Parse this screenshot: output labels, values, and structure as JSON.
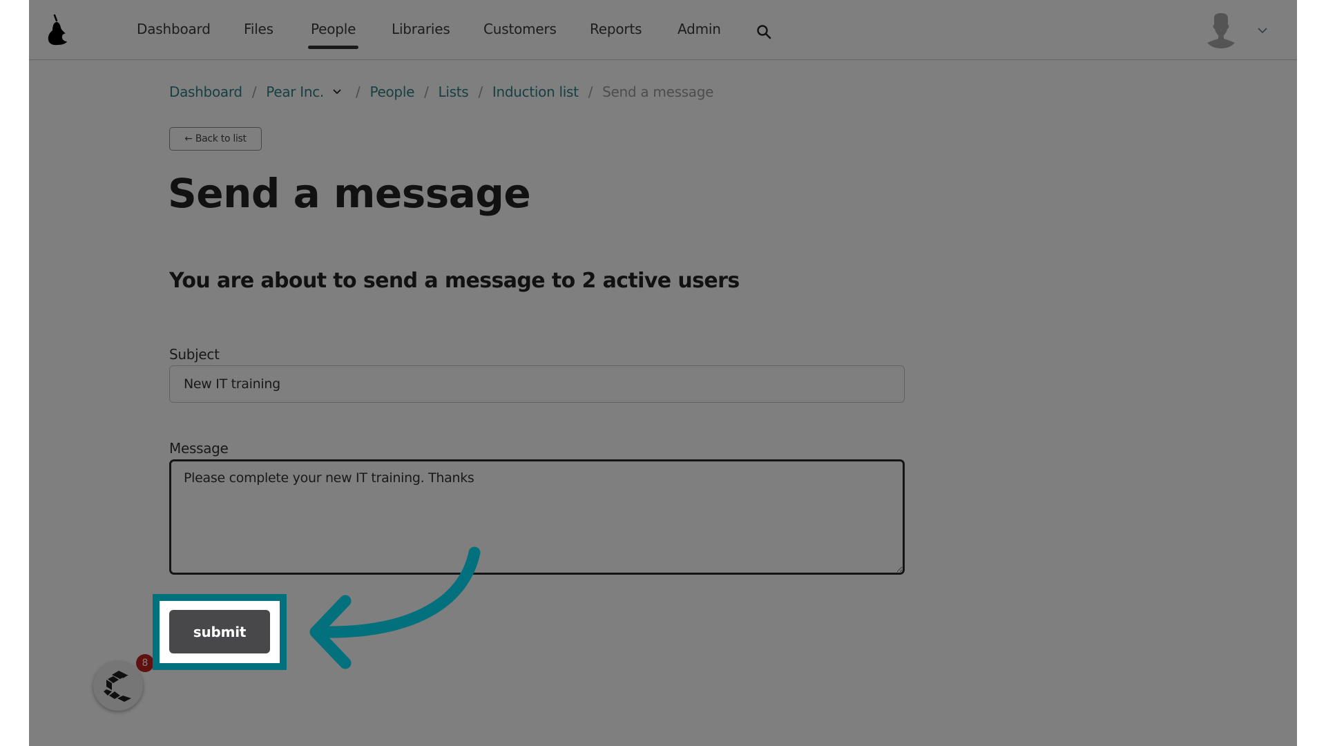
{
  "nav": {
    "items": [
      {
        "label": "Dashboard",
        "active": false
      },
      {
        "label": "Files",
        "active": false
      },
      {
        "label": "People",
        "active": true
      },
      {
        "label": "Libraries",
        "active": false
      },
      {
        "label": "Customers",
        "active": false
      },
      {
        "label": "Reports",
        "active": false
      },
      {
        "label": "Admin",
        "active": false
      }
    ],
    "search_icon": "search-icon",
    "avatar_icon": "user-avatar-icon",
    "avatar_menu_icon": "chevron-down-icon"
  },
  "breadcrumb": {
    "items": [
      "Dashboard",
      "Pear Inc.",
      "People",
      "Lists",
      "Induction list"
    ],
    "current": "Send a message",
    "separator": "/"
  },
  "back_button": {
    "label": "← Back to list"
  },
  "page": {
    "title": "Send a message",
    "subtitle": "You are about to send a message to 2 active users"
  },
  "form": {
    "subject_label": "Subject",
    "subject_value": "New IT training",
    "message_label": "Message",
    "message_value": "Please complete your new IT training. Thanks",
    "submit_label": "submit"
  },
  "chat_widget": {
    "badge_count": "8"
  },
  "colors": {
    "highlight": "#02717d",
    "link": "#2f7f88",
    "submit_bg": "#48484b",
    "badge": "#c0201d"
  }
}
